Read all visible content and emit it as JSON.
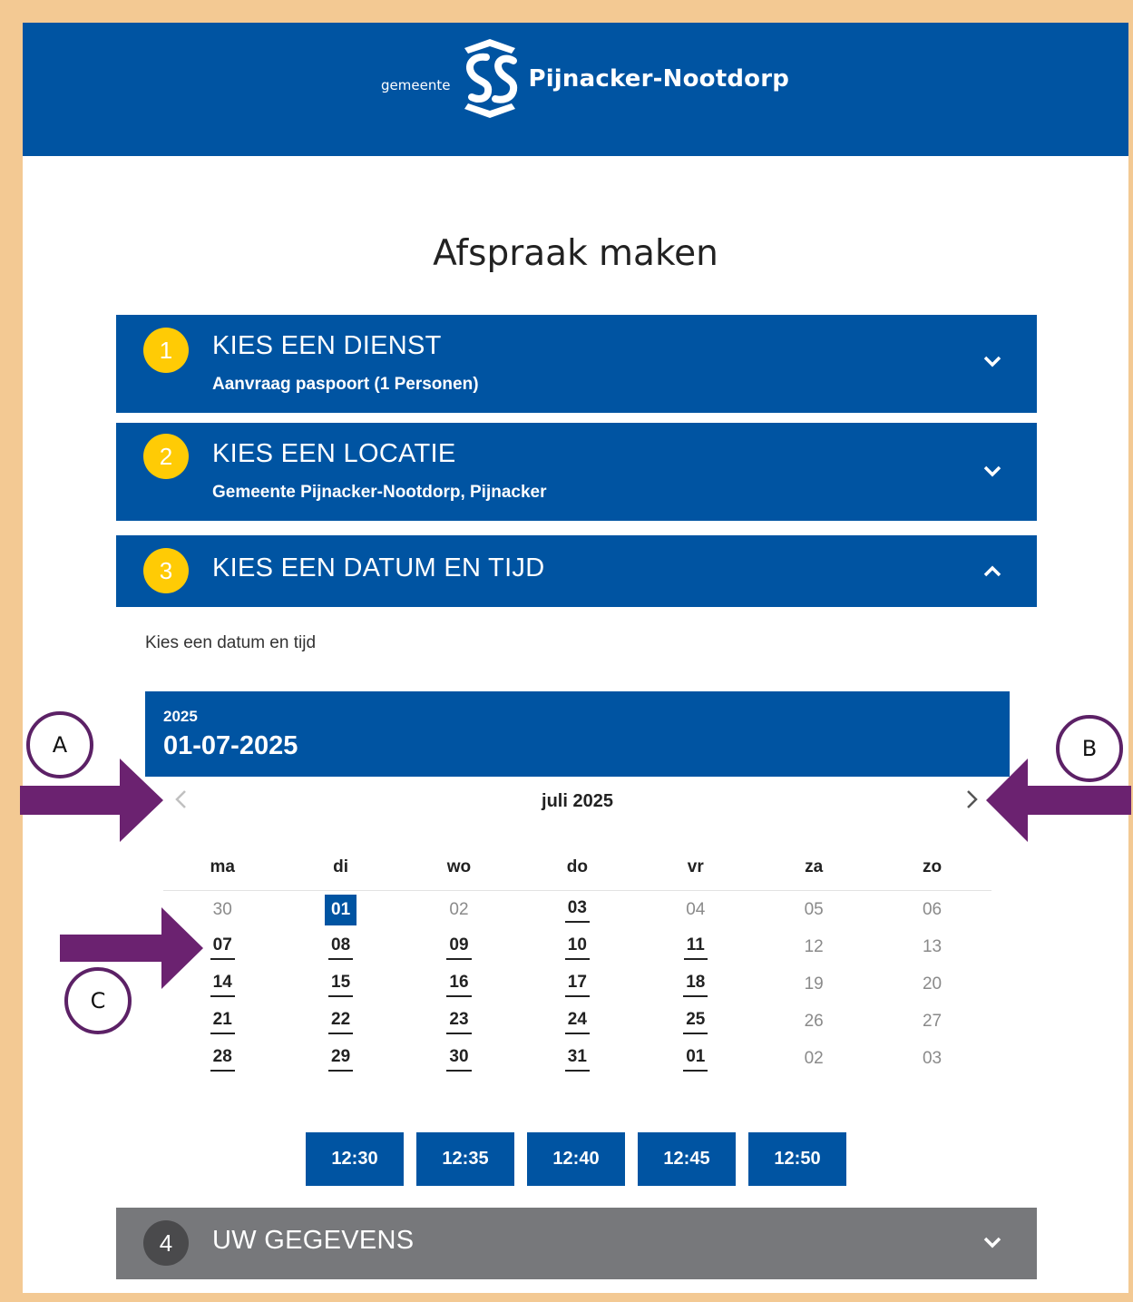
{
  "header": {
    "logo_prefix": "gemeente",
    "logo_name": "Pijnacker-Nootdorp",
    "brand_color": "#0054a2"
  },
  "page_title": "Afspraak maken",
  "steps": [
    {
      "number": "1",
      "title": "KIES EEN DIENST",
      "subtitle": "Aanvraag paspoort (1 Personen)",
      "state": "collapsed",
      "icon": "chevron-down-icon"
    },
    {
      "number": "2",
      "title": "KIES EEN LOCATIE",
      "subtitle": "Gemeente Pijnacker-Nootdorp, Pijnacker",
      "state": "collapsed",
      "icon": "chevron-down-icon"
    },
    {
      "number": "3",
      "title": "KIES EEN DATUM EN TIJD",
      "subtitle": "",
      "state": "expanded",
      "icon": "chevron-up-icon"
    },
    {
      "number": "4",
      "title": "UW GEGEVENS",
      "subtitle": "",
      "state": "disabled",
      "icon": "chevron-down-icon"
    }
  ],
  "datetime": {
    "intro": "Kies een datum en tijd",
    "year": "2025",
    "selected_date": "01-07-2025",
    "month_label": "juli 2025",
    "weekdays": [
      "ma",
      "di",
      "wo",
      "do",
      "vr",
      "za",
      "zo"
    ],
    "weeks": [
      [
        {
          "d": "30",
          "s": "dis"
        },
        {
          "d": "01",
          "s": "sel"
        },
        {
          "d": "02",
          "s": "dis"
        },
        {
          "d": "03",
          "s": "avail"
        },
        {
          "d": "04",
          "s": "dis"
        },
        {
          "d": "05",
          "s": "dis"
        },
        {
          "d": "06",
          "s": "dis"
        }
      ],
      [
        {
          "d": "07",
          "s": "avail"
        },
        {
          "d": "08",
          "s": "avail"
        },
        {
          "d": "09",
          "s": "avail"
        },
        {
          "d": "10",
          "s": "avail"
        },
        {
          "d": "11",
          "s": "avail"
        },
        {
          "d": "12",
          "s": "dis"
        },
        {
          "d": "13",
          "s": "dis"
        }
      ],
      [
        {
          "d": "14",
          "s": "avail"
        },
        {
          "d": "15",
          "s": "avail"
        },
        {
          "d": "16",
          "s": "avail"
        },
        {
          "d": "17",
          "s": "avail"
        },
        {
          "d": "18",
          "s": "avail"
        },
        {
          "d": "19",
          "s": "dis"
        },
        {
          "d": "20",
          "s": "dis"
        }
      ],
      [
        {
          "d": "21",
          "s": "avail"
        },
        {
          "d": "22",
          "s": "avail"
        },
        {
          "d": "23",
          "s": "avail"
        },
        {
          "d": "24",
          "s": "avail"
        },
        {
          "d": "25",
          "s": "avail"
        },
        {
          "d": "26",
          "s": "dis"
        },
        {
          "d": "27",
          "s": "dis"
        }
      ],
      [
        {
          "d": "28",
          "s": "avail"
        },
        {
          "d": "29",
          "s": "avail"
        },
        {
          "d": "30",
          "s": "avail"
        },
        {
          "d": "31",
          "s": "avail"
        },
        {
          "d": "01",
          "s": "avail"
        },
        {
          "d": "02",
          "s": "dis"
        },
        {
          "d": "03",
          "s": "dis"
        }
      ]
    ],
    "times": [
      "12:30",
      "12:35",
      "12:40",
      "12:45",
      "12:50"
    ]
  },
  "annotations": {
    "label_a": "A",
    "label_b": "B",
    "label_c": "C",
    "arrow_color": "#6b2270",
    "frame_color": "#f3c993"
  }
}
